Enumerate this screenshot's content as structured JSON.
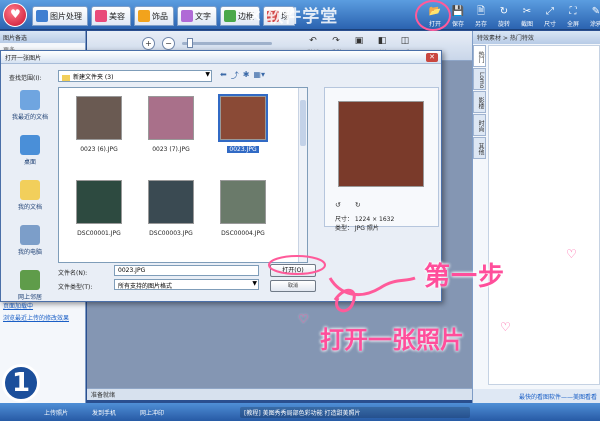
{
  "app": {
    "tabs": [
      {
        "label": "图片处理",
        "color": "#3f7fd1"
      },
      {
        "label": "美容",
        "color": "#e84a7a"
      },
      {
        "label": "饰品",
        "color": "#f2a31c"
      },
      {
        "label": "文字",
        "color": "#b06ad6"
      },
      {
        "label": "边框",
        "color": "#4aa84a"
      },
      {
        "label": "场",
        "color": "#d24a4a"
      }
    ],
    "brand": "软件学堂",
    "actions": [
      {
        "label": "打开",
        "glyph": "📂"
      },
      {
        "label": "保存",
        "glyph": "💾"
      },
      {
        "label": "另存",
        "glyph": "🗎"
      },
      {
        "label": "旋转",
        "glyph": "↻"
      },
      {
        "label": "截图",
        "glyph": "✂"
      },
      {
        "label": "尺寸",
        "glyph": "⤢"
      },
      {
        "label": "全屏",
        "glyph": "⛶"
      },
      {
        "label": "涂鸦",
        "glyph": "✎"
      }
    ]
  },
  "left_panel": {
    "title": "图片备选",
    "subtitle": "更多",
    "links": [
      "页面加载中",
      "浏览最近上传的修改效果"
    ]
  },
  "work_toolbar": {
    "buttons": [
      {
        "label": "撤销",
        "glyph": "↶"
      },
      {
        "label": "重做",
        "glyph": "↷"
      },
      {
        "label": "原图",
        "glyph": "▣"
      },
      {
        "label": "对比",
        "glyph": "◧"
      },
      {
        "label": "预览",
        "glyph": "◫"
      }
    ]
  },
  "status_text": "准备就绪",
  "right_panel": {
    "header": "特效素材 > 热门特效",
    "tabs": [
      "热门",
      "Lomo",
      "影楼",
      "时尚",
      "其他"
    ],
    "footer": "最快的看图软件——美图看看"
  },
  "bottom_bar": {
    "items": [
      "上传照片",
      "发到手机",
      "网上冲印"
    ],
    "promo": "[教程] 美图秀秀局部色彩功能 打造甜美照片"
  },
  "dialog": {
    "title": "打开一张图片",
    "look_in_label": "查找范围(I):",
    "look_in_value": "新建文件夹 (3)",
    "places": [
      {
        "label": "我最近的文档",
        "color": "#6fa5e0"
      },
      {
        "label": "桌面",
        "color": "#4a8fd8"
      },
      {
        "label": "我的文档",
        "color": "#f2cf5b"
      },
      {
        "label": "我的电脑",
        "color": "#7c9ec9"
      },
      {
        "label": "网上邻居",
        "color": "#5f9c4a"
      }
    ],
    "files": [
      {
        "name": "0023 (6).JPG",
        "color": "#6a5a52"
      },
      {
        "name": "0023 (7).JPG",
        "color": "#a9708a"
      },
      {
        "name": "0023.JPG",
        "color": "#8a4a36"
      },
      {
        "name": "DSC00001.JPG",
        "color": "#2d4a40"
      },
      {
        "name": "DSC00003.JPG",
        "color": "#3a4a52"
      },
      {
        "name": "DSC00004.JPG",
        "color": "#6a7a6a"
      }
    ],
    "selected_index": 2,
    "preview": {
      "size_label": "尺寸： 1224 × 1632",
      "type_label": "类型： JPG 照片",
      "color": "#7a3a2a"
    },
    "filename_label": "文件名(N):",
    "filename_value": "0023.JPG",
    "filetype_label": "文件类型(T):",
    "filetype_value": "所有支持的图片格式",
    "open_label": "打开(O)",
    "cancel_label": "取消"
  },
  "overlay": {
    "step_title": "第一步",
    "step_sub": "打开一张照片",
    "step_number": "1"
  }
}
